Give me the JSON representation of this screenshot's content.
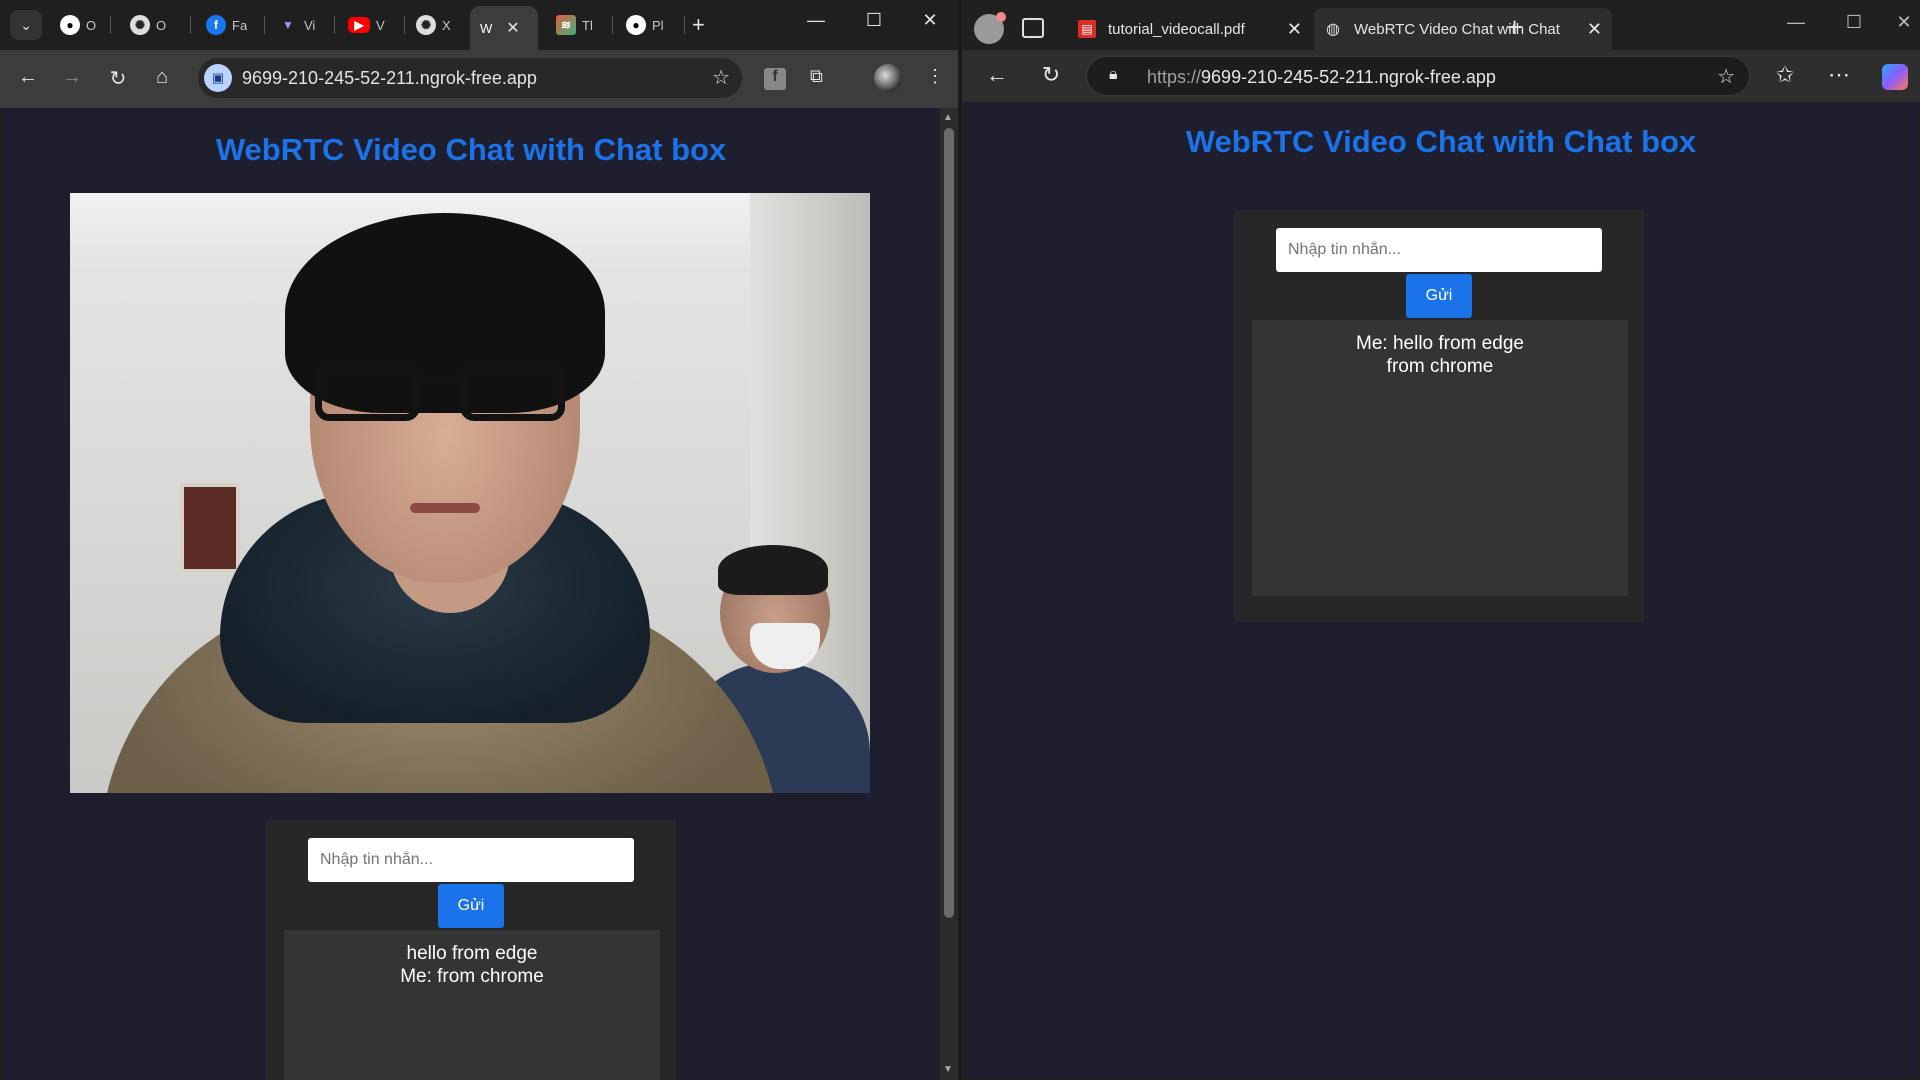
{
  "chrome": {
    "tabs": [
      {
        "label": "O",
        "icon": "github-icon"
      },
      {
        "label": "O",
        "icon": "openai-icon"
      },
      {
        "label": "Fa",
        "icon": "facebook-icon"
      },
      {
        "label": "Vi",
        "icon": "vite-icon"
      },
      {
        "label": "V",
        "icon": "youtube-icon"
      },
      {
        "label": "X",
        "icon": "openai-icon"
      },
      {
        "label": "W",
        "icon": "webrtc-icon",
        "active": true
      },
      {
        "label": "Tl",
        "icon": "app-icon"
      },
      {
        "label": "Pl",
        "icon": "github-icon"
      }
    ],
    "url": "9699-210-245-52-211.ngrok-free.app"
  },
  "edge": {
    "tabs": [
      {
        "label": "tutorial_videocall.pdf",
        "icon": "pdf-icon"
      },
      {
        "label": "WebRTC Video Chat with Chat",
        "icon": "globe-icon",
        "active": true
      }
    ],
    "url_protocol": "https://",
    "url_host": "9699-210-245-52-211.ngrok-free.app"
  },
  "app": {
    "title": "WebRTC Video Chat with Chat box",
    "input_placeholder": "Nhập tin nhắn...",
    "send_label": "Gửi"
  },
  "chrome_chat": {
    "messages": [
      "hello from edge",
      "Me: from chrome"
    ]
  },
  "edge_chat": {
    "messages": [
      "Me: hello from edge",
      "from chrome"
    ]
  },
  "colors": {
    "page_bg": "#1e1e2f",
    "accent": "#1a73e8",
    "chat_panel": "#272727",
    "messages_bg": "#343434"
  }
}
